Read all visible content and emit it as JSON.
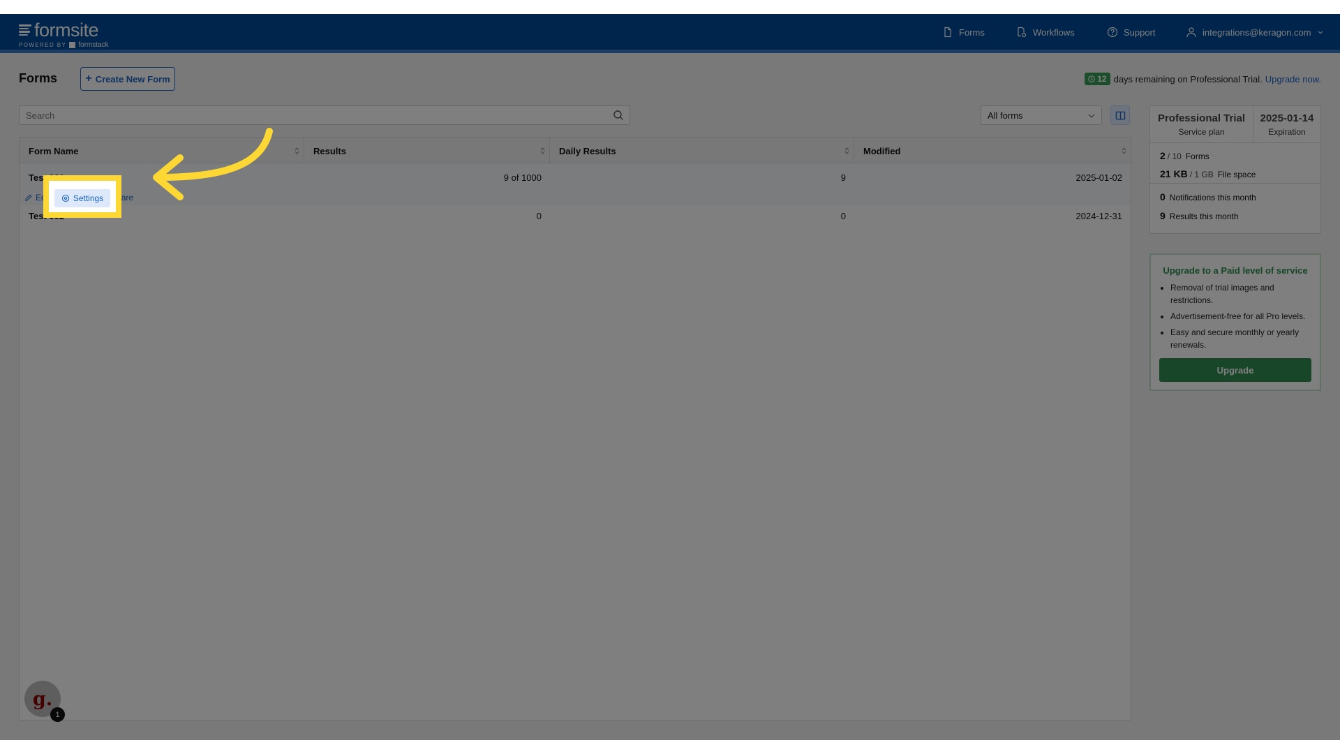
{
  "header": {
    "logo_text": "formsite",
    "logo_sub_prefix": "POWERED BY",
    "logo_sub_brand": "formstack",
    "nav": [
      {
        "label": "Forms",
        "icon": "document-icon"
      },
      {
        "label": "Workflows",
        "icon": "workflow-icon"
      },
      {
        "label": "Support",
        "icon": "help-icon"
      },
      {
        "label": "integrations@keragon.com",
        "icon": "user-icon"
      }
    ]
  },
  "page": {
    "title": "Forms",
    "create_button": "Create New Form",
    "trial_days": "12",
    "trial_text": "days remaining on Professional Trial.",
    "trial_link": "Upgrade now."
  },
  "toolbar": {
    "search_placeholder": "Search",
    "filter_value": "All forms"
  },
  "table": {
    "columns": [
      "Form Name",
      "Results",
      "Daily Results",
      "Modified"
    ],
    "rows": [
      {
        "name": "Test 001",
        "results": "9 of 1000",
        "daily": "9",
        "modified": "2025-01-02"
      },
      {
        "name": "Test 002",
        "results": "0",
        "daily": "0",
        "modified": "2024-12-31"
      }
    ],
    "row_actions": [
      "Edit",
      "Settings",
      "Share"
    ]
  },
  "plan": {
    "name": "Professional Trial",
    "name_sub": "Service plan",
    "expiration": "2025-01-14",
    "expiration_sub": "Expiration",
    "forms_used": "2",
    "forms_total": "/ 10",
    "forms_label": "Forms",
    "space_used": "21 KB",
    "space_total": "/ 1 GB",
    "space_label": "File space",
    "notifications": "0",
    "notifications_label": "Notifications this month",
    "results": "9",
    "results_label": "Results this month"
  },
  "upsell": {
    "title": "Upgrade to a Paid level of service",
    "bullets": [
      "Removal of trial images and restrictions.",
      "Advertisement-free for all Pro levels.",
      "Easy and secure monthly or yearly renewals."
    ],
    "button": "Upgrade"
  },
  "widget": {
    "letter": "g.",
    "badge": "1"
  },
  "colors": {
    "header": "#004a99",
    "accent": "#1a63c3",
    "highlight": "#fdd835",
    "success": "#2f8f50"
  }
}
